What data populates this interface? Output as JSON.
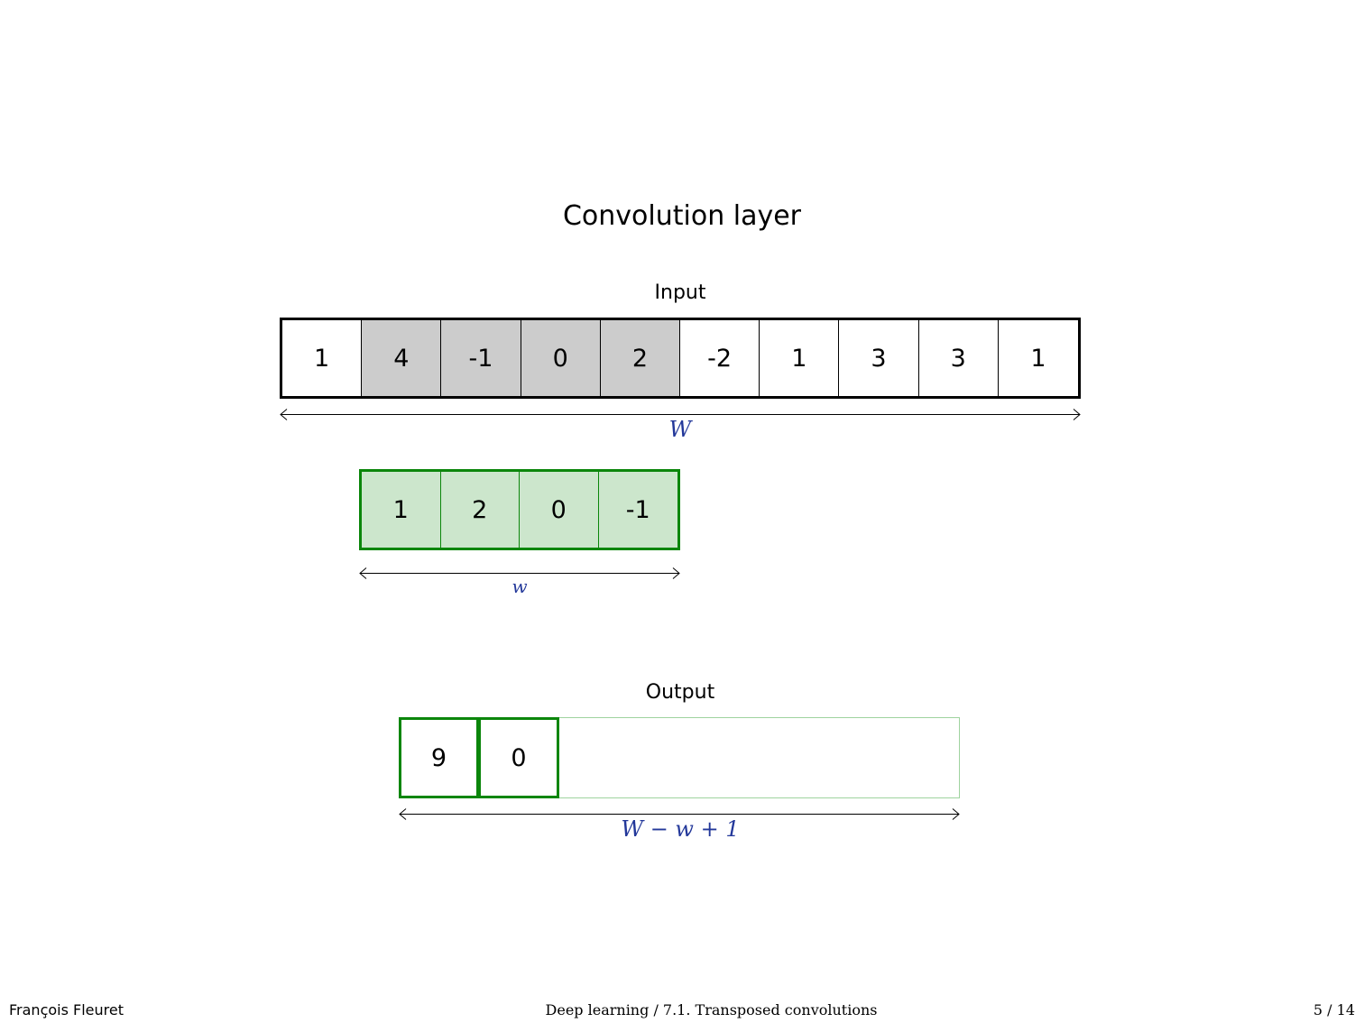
{
  "slide": {
    "title": "Convolution layer"
  },
  "input": {
    "label": "Input",
    "values": [
      "1",
      "4",
      "-1",
      "0",
      "2",
      "-2",
      "1",
      "3",
      "3",
      "1"
    ],
    "highlighted_indices": [
      1,
      2,
      3,
      4
    ],
    "dimension_label": "W"
  },
  "kernel": {
    "values": [
      "1",
      "2",
      "0",
      "-1"
    ],
    "dimension_label": "w"
  },
  "output": {
    "label": "Output",
    "values": [
      "9",
      "0"
    ],
    "total_cells": 7,
    "dimension_label": "W − w + 1"
  },
  "footer": {
    "author": "François Fleuret",
    "course": "Deep learning / 7.1. Transposed convolutions",
    "page": "5 / 14"
  },
  "colors": {
    "highlight": "#cccccc",
    "kernel_fill": "#cce6cc",
    "kernel_border": "#0b860b",
    "output_frame": "#9fd39f",
    "math_text": "#23389a"
  }
}
